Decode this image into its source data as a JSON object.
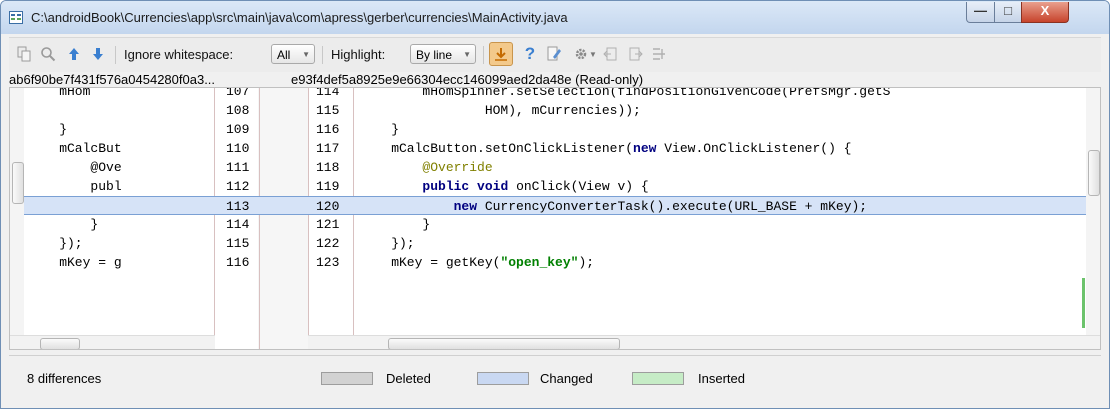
{
  "window": {
    "title": "C:\\androidBook\\Currencies\\app\\src\\main\\java\\com\\apress\\gerber\\currencies\\MainActivity.java",
    "minimize_glyph": "—",
    "maximize_glyph": "□",
    "close_glyph": "X"
  },
  "toolbar": {
    "ignore_whitespace_label": "Ignore whitespace:",
    "ignore_whitespace_value": "All",
    "highlight_label": "Highlight:",
    "highlight_value": "By line",
    "help_glyph": "?"
  },
  "diff": {
    "left_revision": "ab6f90be7f431f576a0454280f0a3...",
    "right_revision": "e93f4def5a8925e9e66304ecc146099aed2da48e (Read-only)",
    "rows": [
      {
        "left_code": "    mHom",
        "left_num": "107",
        "right_num": "114",
        "right_code": "        mHomSpinner.setSelection(findPositionGivenCode(PrefsMgr.getS"
      },
      {
        "left_code": "",
        "left_num": "108",
        "right_num": "115",
        "right_code": "                HOM), mCurrencies));"
      },
      {
        "left_code": "    }",
        "left_num": "109",
        "right_num": "116",
        "right_code": "    }"
      },
      {
        "left_code": "    mCalcBut",
        "left_num": "110",
        "right_num": "117",
        "right_code": "    mCalcButton.setOnClickListener(new View.OnClickListener() {"
      },
      {
        "left_code": "        @Ove",
        "left_num": "111",
        "right_num": "118",
        "right_code": "        @Override"
      },
      {
        "left_code": "        publ",
        "left_num": "112",
        "right_num": "119",
        "right_code": "        public void onClick(View v) {"
      },
      {
        "left_code": "",
        "left_num": "113",
        "right_num": "120",
        "right_code": "            new CurrencyConverterTask().execute(URL_BASE + mKey);"
      },
      {
        "left_code": "        }",
        "left_num": "114",
        "right_num": "121",
        "right_code": "        }"
      },
      {
        "left_code": "    });",
        "left_num": "115",
        "right_num": "122",
        "right_code": "    });"
      },
      {
        "left_code": "    mKey = g",
        "left_num": "116",
        "right_num": "123",
        "right_code": "    mKey = getKey(\"open_key\");"
      }
    ]
  },
  "status": {
    "differences": "8 differences",
    "deleted_label": "Deleted",
    "changed_label": "Changed",
    "inserted_label": "Inserted"
  },
  "colors": {
    "deleted": "#d2d2d2",
    "changed": "#c9d8f2",
    "inserted": "#c6ecc6"
  }
}
